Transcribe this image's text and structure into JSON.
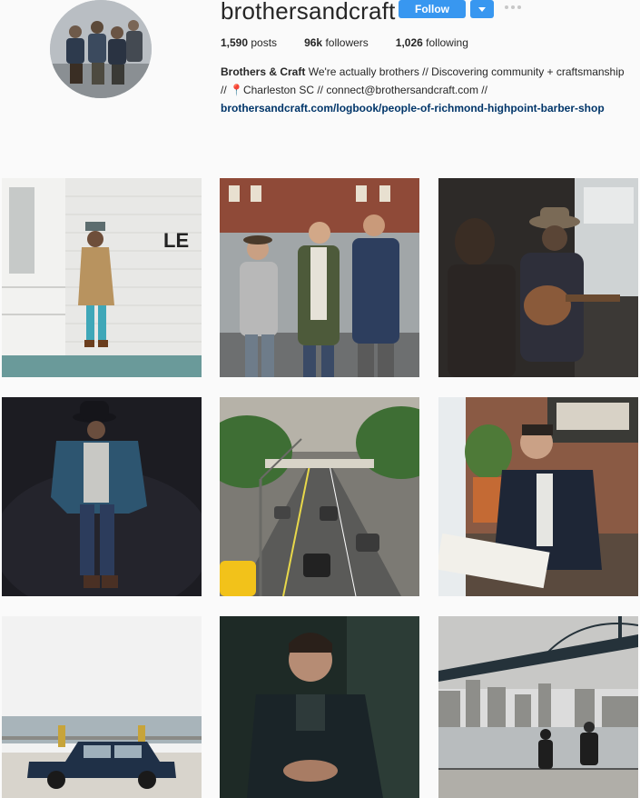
{
  "profile": {
    "username": "brothersandcraft",
    "follow_label": "Follow",
    "posts_count": "1,590",
    "posts_label": "posts",
    "followers_count": "96k",
    "followers_label": "followers",
    "following_count": "1,026",
    "following_label": "following",
    "bio_name": "Brothers & Craft",
    "bio_line1": "We're actually brothers // Discovering community + craftsmanship",
    "bio_line2_prefix": "// ",
    "bio_line2_pin": "📍",
    "bio_line2": "Charleston SC // connect@brothersandcraft.com //",
    "bio_link": "brothersandcraft.com/logbook/people-of-richmond-highpoint-barber-shop"
  },
  "colors": {
    "accent": "#3897f0",
    "link": "#003569",
    "text": "#262626",
    "background": "#fafafa"
  },
  "posts": [
    {
      "alt": "man-in-camel-coat-white-brick-wall"
    },
    {
      "alt": "three-men-walking-city-street"
    },
    {
      "alt": "man-playing-guitar-by-window"
    },
    {
      "alt": "man-in-black-hat-dark-studio"
    },
    {
      "alt": "highway-traffic-through-fence"
    },
    {
      "alt": "man-reading-newspaper-cafe"
    },
    {
      "alt": "blue-vintage-car-waterfront"
    },
    {
      "alt": "man-portrait-dark-green"
    },
    {
      "alt": "people-walking-under-bridge"
    }
  ]
}
